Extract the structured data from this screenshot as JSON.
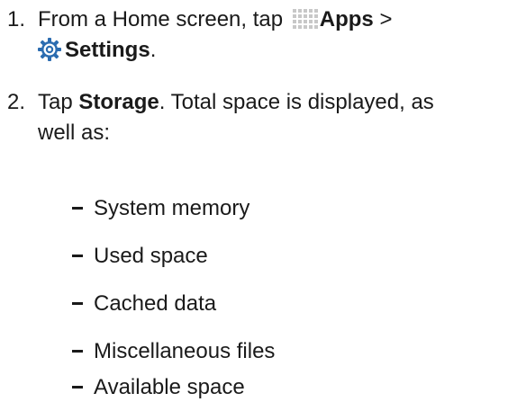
{
  "steps": [
    {
      "number": "1.",
      "line1_prefix": "From a Home screen, tap",
      "apps_label": "Apps",
      "separator": ">",
      "settings_label": "Settings",
      "end_punct": ".",
      "apps_icon": "apps-grid-icon",
      "settings_icon": "settings-gear-icon"
    },
    {
      "number": "2.",
      "prefix": "Tap",
      "storage_label": "Storage",
      "line1_rest": ". Total space is displayed, as",
      "line2": "well as:"
    }
  ],
  "sub_items": [
    "System memory",
    "Used space",
    "Cached data",
    "Miscellaneous files",
    "Available space"
  ],
  "colors": {
    "text": "#1a1a1a",
    "apps_icon": "#c8c8c8",
    "settings_icon": "#2b6cb0"
  }
}
